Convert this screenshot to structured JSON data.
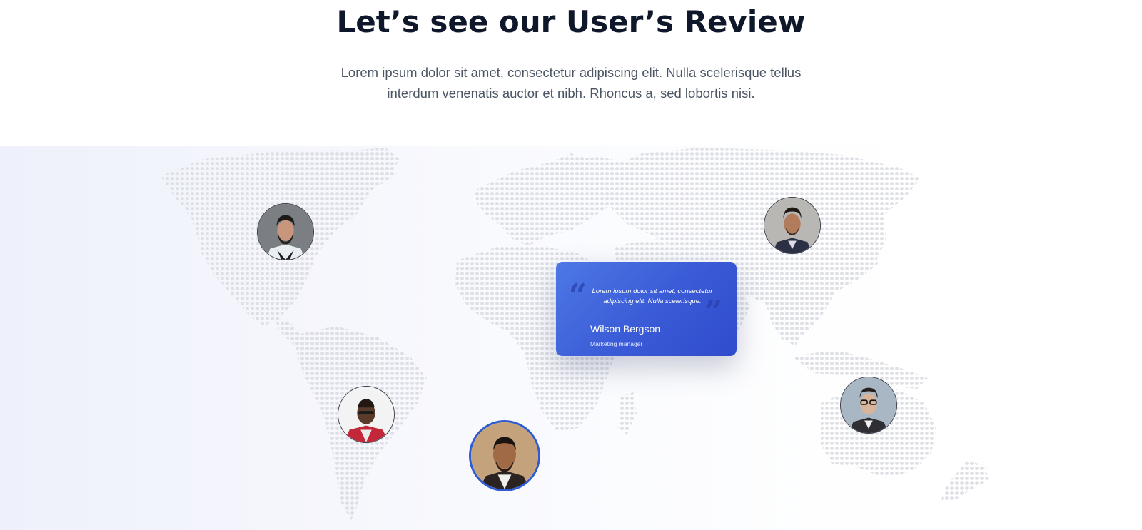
{
  "header": {
    "title": "Let’s see our User’s Review",
    "description_line1": "Lorem ipsum dolor sit amet, consectetur adipiscing elit. Nulla scelerisque tellus",
    "description_line2": "interdum venenatis auctor et nibh. Rhoncus a, sed lobortis nisi."
  },
  "map": {
    "icon": "world-map-dots",
    "dot_color": "#dcdde2"
  },
  "reviewers": [
    {
      "id": "north-america",
      "icon": "person-avatar",
      "active": false
    },
    {
      "id": "south-america",
      "icon": "person-avatar",
      "active": false
    },
    {
      "id": "africa",
      "icon": "person-avatar",
      "active": true
    },
    {
      "id": "asia",
      "icon": "person-avatar",
      "active": false
    },
    {
      "id": "oceania",
      "icon": "person-avatar",
      "active": false
    }
  ],
  "review_card": {
    "quote": "Lorem ipsum dolor sit amet, consectetur adipiscing elit. Nulla scelerisque.",
    "name": "Wilson Bergson",
    "role": "Marketing manager",
    "open_quote_icon": "quote-open-icon",
    "close_quote_icon": "quote-close-icon"
  },
  "colors": {
    "title": "#0f172a",
    "body_text": "#4b5563",
    "card_start": "#4d78e6",
    "card_end": "#2f4ccc",
    "active_ring": "#2f5bd1"
  }
}
